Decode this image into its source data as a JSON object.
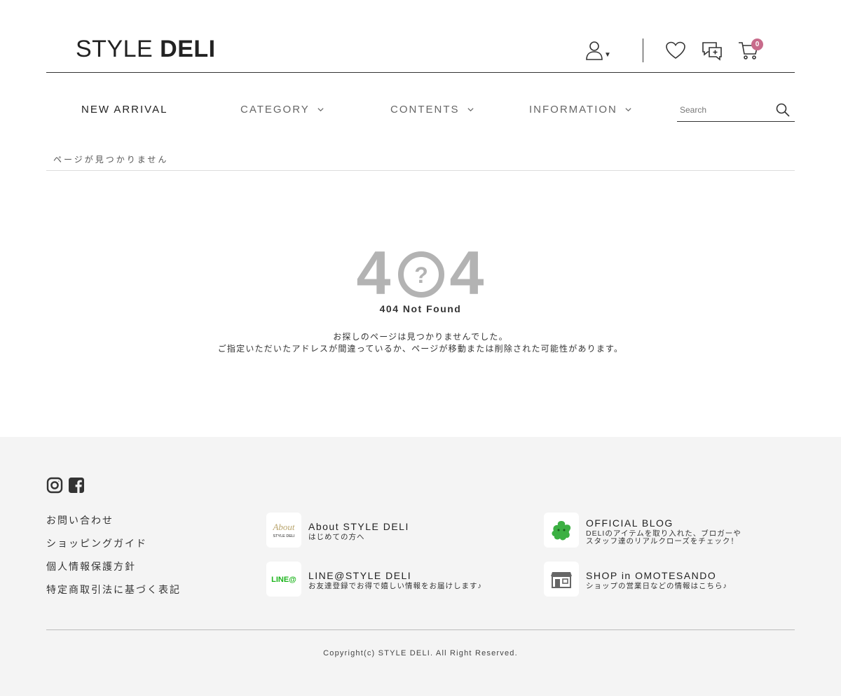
{
  "header": {
    "logo_thin": "STYLE ",
    "logo_bold": "DELI",
    "cart_count": "0",
    "icons": [
      "user-icon",
      "heart-icon",
      "chat-icon",
      "cart-icon"
    ]
  },
  "nav": {
    "items": [
      {
        "label": "NEW ARRIVAL"
      },
      {
        "label": "CATEGORY"
      },
      {
        "label": "CONTENTS"
      },
      {
        "label": "INFORMATION"
      }
    ],
    "search_placeholder": "Search"
  },
  "breadcrumb": {
    "current": "ページが見つかりません"
  },
  "error": {
    "code": "404",
    "title": "404 Not Found",
    "message_line1": "お探しのページは見つかりませんでした。",
    "message_line2": "ご指定いただいたアドレスが間違っているか、ページが移動または削除された可能性があります。"
  },
  "footer": {
    "social": [
      "instagram-icon",
      "facebook-icon"
    ],
    "links": [
      "お問い合わせ",
      "ショッピングガイド",
      "個人情報保護方針",
      "特定商取引法に基づく表記"
    ],
    "cards": [
      {
        "title": "About STYLE DELI",
        "sub_lines": [
          "はじめての方へ"
        ],
        "thumb_script": "About",
        "thumb_text": "STYLE DELI"
      },
      {
        "title": "OFFICIAL BLOG",
        "sub_lines": [
          "DELIのアイテムを取り入れた、ブロガーや",
          "スタッフ達のリアルクローズをチェック！"
        ]
      },
      {
        "title": "LINE@STYLE DELI",
        "sub_lines": [
          "お友達登録でお得で嬉しい情報をお届けします♪"
        ],
        "thumb_text": "LINE@"
      },
      {
        "title": "SHOP in OMOTESANDO",
        "sub_lines": [
          "ショップの営業日などの情報はこちら♪"
        ]
      }
    ],
    "copyright": "Copyright(c) STYLE DELI. All Right Reserved."
  },
  "colors": {
    "badge": "#c86b8b",
    "line_green": "#1db51d",
    "blog_green": "#3cb043",
    "error_gray": "#b3b3b3",
    "footer_bg": "#f4f4f4"
  }
}
